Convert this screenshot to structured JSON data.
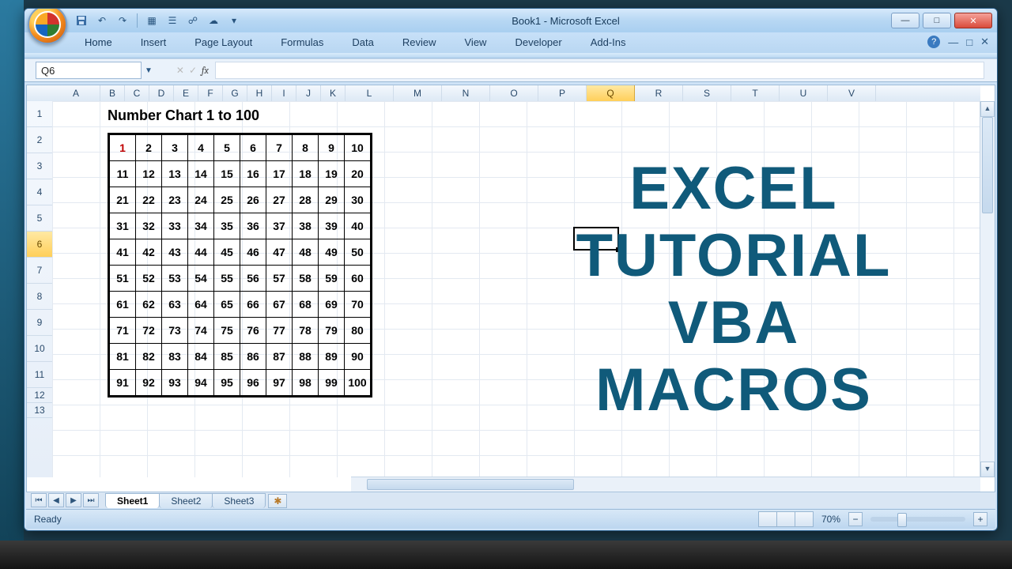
{
  "window": {
    "title": "Book1 - Microsoft Excel",
    "min": "—",
    "max": "□",
    "close": "✕"
  },
  "qat": {
    "save": "💾",
    "undo": "↶",
    "redo": "↷"
  },
  "ribbon": {
    "tabs": [
      "Home",
      "Insert",
      "Page Layout",
      "Formulas",
      "Data",
      "Review",
      "View",
      "Developer",
      "Add-Ins"
    ]
  },
  "namebox": {
    "value": "Q6"
  },
  "fx": {
    "label": "fx"
  },
  "columns": [
    "A",
    "B",
    "C",
    "D",
    "E",
    "F",
    "G",
    "H",
    "I",
    "J",
    "K",
    "L",
    "M",
    "N",
    "O",
    "P",
    "Q",
    "R",
    "S",
    "T",
    "U",
    "V"
  ],
  "col_widths": {
    "narrow": 30,
    "wide": 60
  },
  "selected_col": "Q",
  "rows": [
    "1",
    "2",
    "3",
    "4",
    "5",
    "6",
    "7",
    "8",
    "9",
    "10",
    "11",
    "12",
    "13"
  ],
  "selected_row": "6",
  "chart": {
    "title": "Number Chart 1 to 100",
    "rows": [
      [
        "1",
        "2",
        "3",
        "4",
        "5",
        "6",
        "7",
        "8",
        "9",
        "10"
      ],
      [
        "11",
        "12",
        "13",
        "14",
        "15",
        "16",
        "17",
        "18",
        "19",
        "20"
      ],
      [
        "21",
        "22",
        "23",
        "24",
        "25",
        "26",
        "27",
        "28",
        "29",
        "30"
      ],
      [
        "31",
        "32",
        "33",
        "34",
        "35",
        "36",
        "37",
        "38",
        "39",
        "40"
      ],
      [
        "41",
        "42",
        "43",
        "44",
        "45",
        "46",
        "47",
        "48",
        "49",
        "50"
      ],
      [
        "51",
        "52",
        "53",
        "54",
        "55",
        "56",
        "57",
        "58",
        "59",
        "60"
      ],
      [
        "61",
        "62",
        "63",
        "64",
        "65",
        "66",
        "67",
        "68",
        "69",
        "70"
      ],
      [
        "71",
        "72",
        "73",
        "74",
        "75",
        "76",
        "77",
        "78",
        "79",
        "80"
      ],
      [
        "81",
        "82",
        "83",
        "84",
        "85",
        "86",
        "87",
        "88",
        "89",
        "90"
      ],
      [
        "91",
        "92",
        "93",
        "94",
        "95",
        "96",
        "97",
        "98",
        "99",
        "100"
      ]
    ]
  },
  "overlay": {
    "l1": "EXCEL",
    "l2": "TUTORIAL",
    "l3": "VBA",
    "l4": "MACROS"
  },
  "sheets": {
    "tabs": [
      "Sheet1",
      "Sheet2",
      "Sheet3"
    ],
    "active": "Sheet1"
  },
  "status": {
    "ready": "Ready",
    "zoom": "70%"
  }
}
